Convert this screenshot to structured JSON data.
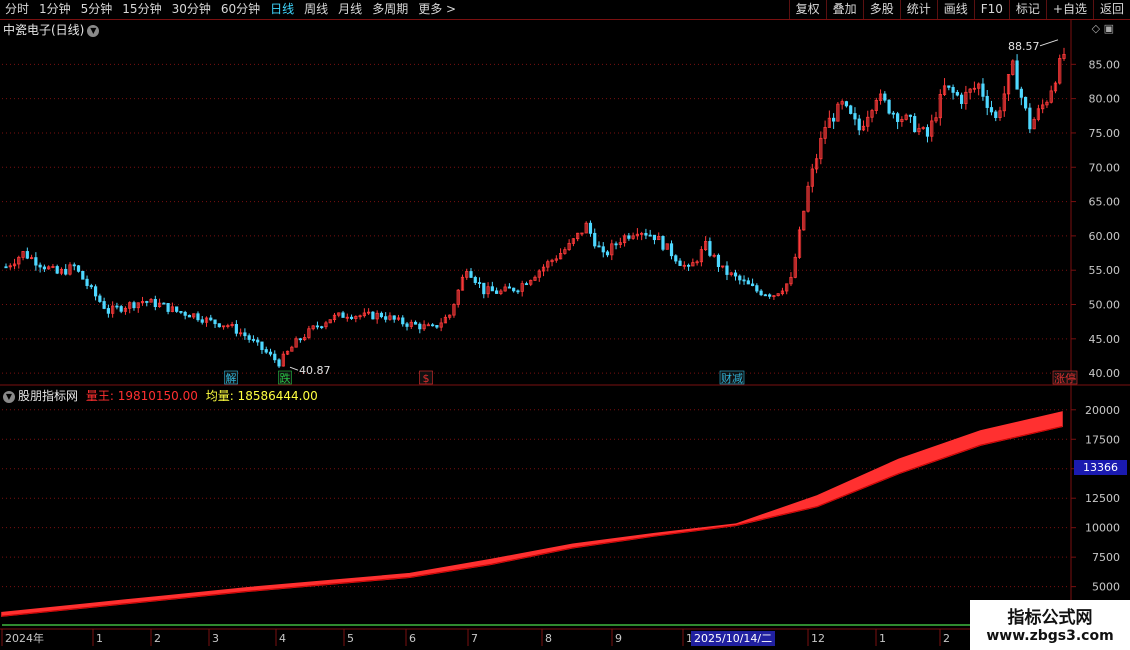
{
  "toolbar": {
    "periods": [
      "分时",
      "1分钟",
      "5分钟",
      "15分钟",
      "30分钟",
      "60分钟",
      "日线",
      "周线",
      "月线",
      "多周期",
      "更多 >"
    ],
    "active_period": "日线",
    "actions": [
      "复权",
      "叠加",
      "多股",
      "统计",
      "画线",
      "F10",
      "标记",
      "+自选",
      "返回"
    ]
  },
  "price_panel": {
    "title": "中瓷电子(日线)",
    "y_ticks": [
      "85.00",
      "80.00",
      "75.00",
      "70.00",
      "65.00",
      "60.00",
      "55.00",
      "50.00",
      "45.00",
      "40.00"
    ],
    "high_label": "88.57",
    "low_label": "40.87",
    "event_markers": [
      {
        "text": "解",
        "color": "#2fb4d8"
      },
      {
        "text": "跌",
        "color": "#27c244"
      },
      {
        "text": "$",
        "color": "#e03030"
      },
      {
        "text": "财减",
        "color": "#2fb4d8"
      },
      {
        "text": "涨停",
        "color": "#e03030"
      }
    ]
  },
  "indicator_panel": {
    "name": "股朋指标网",
    "series_labels": [
      "量王: 19810150.00",
      "均量: 18586444.00"
    ],
    "series_colors": [
      "#ff3030",
      "#ffff40"
    ],
    "y_ticks": [
      "20000",
      "17500",
      "15000",
      "12500",
      "10000",
      "7500",
      "5000"
    ],
    "last_value_tag": "13366"
  },
  "time_axis": {
    "labels": [
      "2024年",
      "1",
      "2",
      "3",
      "4",
      "5",
      "6",
      "7",
      "8",
      "9",
      "10",
      "12",
      "1",
      "2"
    ],
    "cursor_date": "2025/10/14/二"
  },
  "watermark": {
    "line1": "指标公式网",
    "line2": "www.zbgs3.com"
  },
  "colors": {
    "up": "#ff3a3a",
    "down": "#4fd8ff",
    "grid": "#7a1010",
    "axis_text": "#c8c8c8"
  },
  "chart_data": [
    {
      "type": "candlestick",
      "title": "中瓷电子(日线)",
      "xlabel": "",
      "ylabel": "",
      "ylim": [
        39,
        90
      ],
      "x": [
        "2024-01-01",
        "2024-01-15",
        "2024-02-01",
        "2024-02-20",
        "2024-03-05",
        "2024-03-20",
        "2024-04-03",
        "2024-04-18",
        "2024-05-06",
        "2024-05-20",
        "2024-06-03",
        "2024-06-18",
        "2024-07-01",
        "2024-07-15",
        "2024-07-29",
        "2024-08-12",
        "2024-08-26",
        "2024-09-09",
        "2024-09-23",
        "2024-10-08",
        "2024-10-21",
        "2024-11-04",
        "2024-11-18",
        "2024-12-02",
        "2024-12-16",
        "2024-12-30",
        "2025-01-13",
        "2025-02-03",
        "2025-02-17",
        "2025-03-03",
        "2025-03-17",
        "2025-03-31",
        "2025-04-14",
        "2025-04-28",
        "2025-05-12",
        "2025-05-26",
        "2025-06-09",
        "2025-06-23",
        "2025-07-07",
        "2025-07-21",
        "2025-08-04",
        "2025-08-18",
        "2025-09-01",
        "2025-09-15",
        "2025-09-29",
        "2025-10-14",
        "2025-11-03",
        "2025-11-17",
        "2025-12-01",
        "2025-12-15",
        "2025-12-29",
        "2026-01-12",
        "2026-01-26",
        "2026-02-09",
        "2026-02-23",
        "2026-03-09",
        "2026-03-23",
        "2026-04-06"
      ],
      "close": [
        55.5,
        57.5,
        56.0,
        54.5,
        55.5,
        52.0,
        49.0,
        49.8,
        50.5,
        50.0,
        49.0,
        48.5,
        47.5,
        47.0,
        45.5,
        43.5,
        41.5,
        44.5,
        46.5,
        48.0,
        48.6,
        48.3,
        48.5,
        47.5,
        47.0,
        46.5,
        48.5,
        55.5,
        52.0,
        51.8,
        52.5,
        54.5,
        56.5,
        58.5,
        61.5,
        57.0,
        59.5,
        61.0,
        60.0,
        57.5,
        55.0,
        58.5,
        55.0,
        53.5,
        52.0,
        51.5,
        53.5,
        67.0,
        76.0,
        79.0,
        75.5,
        80.5,
        78.0,
        76.5,
        74.5,
        81.5,
        80.0,
        82.0,
        77.0,
        84.5,
        76.0,
        80.0,
        86.5
      ],
      "high_label": 88.57,
      "low_label": 40.87
    },
    {
      "type": "area",
      "title": "股朋指标网",
      "xlabel": "",
      "ylabel": "",
      "ylim": [
        2000,
        21000
      ],
      "series": [
        {
          "name": "量王",
          "values": [
            2800,
            3500,
            4200,
            4900,
            5500,
            6100,
            7300,
            8600,
            9500,
            10300,
            12700,
            15800,
            18200,
            19810
          ]
        },
        {
          "name": "均量",
          "values": [
            2500,
            3200,
            3900,
            4600,
            5200,
            5800,
            6900,
            8300,
            9300,
            10200,
            11800,
            14600,
            17000,
            18586
          ]
        }
      ],
      "x": [
        "2024-01",
        "2024-02",
        "2024-03",
        "2024-04",
        "2024-05",
        "2024-06",
        "2024-08",
        "2024-09",
        "2024-10",
        "2024-12",
        "2025-01",
        "2025-02",
        "2025-03",
        "2025-04"
      ]
    }
  ]
}
